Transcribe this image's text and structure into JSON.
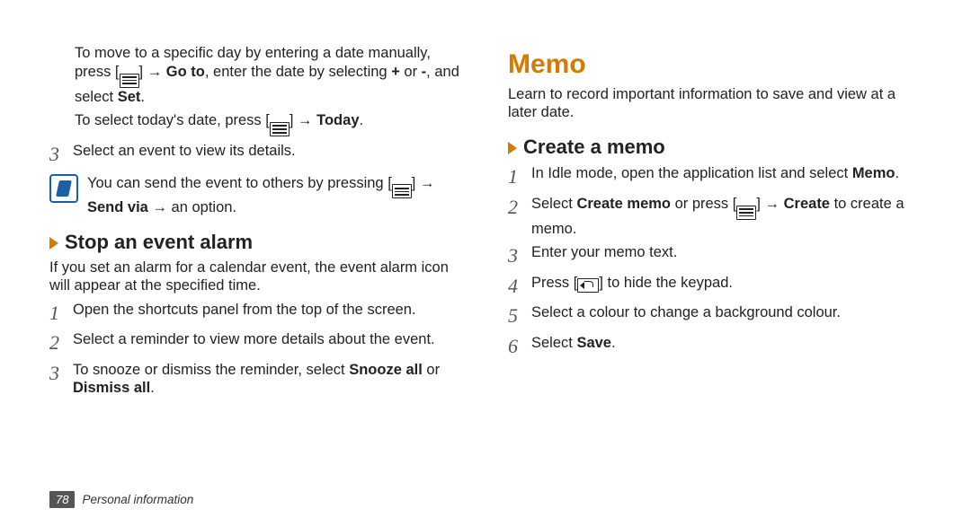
{
  "left": {
    "move_day_1": "To move to a specific day by entering a date manually, press [",
    "move_day_2": "] → ",
    "goto": "Go to",
    "move_day_3": ", enter the date by selecting ",
    "plus": "+",
    "or1": " or ",
    "minus": "-",
    "move_day_4": ", and select ",
    "set": "Set",
    "today_1": "To select today's date, press [",
    "today_2": "] → ",
    "today": "Today",
    "step3": "Select an event to view its details.",
    "note_1": "You can send the event to others by pressing [",
    "note_2": "] → ",
    "sendvia": "Send via",
    "note_3": " → an option.",
    "stop_heading": "Stop an event alarm",
    "stop_intro": "If you set an alarm for a calendar event, the event alarm icon will appear at the specified time.",
    "s1": "Open the shortcuts panel from the top of the screen.",
    "s2": "Select a reminder to view more details about the event.",
    "s3_a": "To snooze or dismiss the reminder, select ",
    "snooze": "Snooze all",
    "s3_b": " or ",
    "dismiss": "Dismiss all",
    "num3": "3",
    "n1": "1",
    "n2": "2",
    "n3": "3"
  },
  "right": {
    "memo": "Memo",
    "intro": "Learn to record important information to save and view at a later date.",
    "create_heading": "Create a memo",
    "r1_a": "In Idle mode, open the application list and select ",
    "memo_b": "Memo",
    "r2_a": "Select ",
    "create_memo": "Create memo",
    "r2_b": " or press [",
    "r2_c": "] → ",
    "create": "Create",
    "r2_d": " to create a memo.",
    "r3": "Enter your memo text.",
    "r4_a": "Press [",
    "r4_b": "] to hide the keypad.",
    "r5": "Select a colour to change a background colour.",
    "r6_a": "Select ",
    "save": "Save",
    "n1": "1",
    "n2": "2",
    "n3": "3",
    "n4": "4",
    "n5": "5",
    "n6": "6"
  },
  "footer": {
    "page": "78",
    "section": "Personal information"
  }
}
